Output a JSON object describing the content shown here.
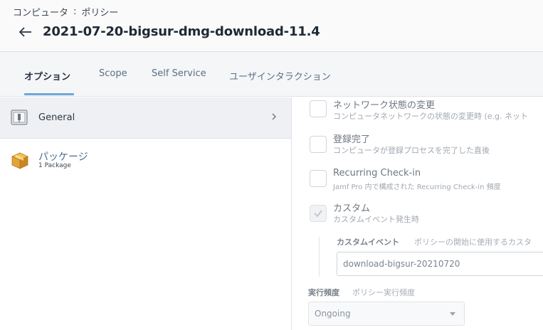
{
  "header": {
    "breadcrumb_parent": "コンピュータ",
    "breadcrumb_sep": ":",
    "breadcrumb_current": "ポリシー",
    "title": "2021-07-20-bigsur-dmg-download-11.4"
  },
  "tabs": [
    {
      "label": "オプション",
      "active": true
    },
    {
      "label": "Scope",
      "active": false
    },
    {
      "label": "Self Service",
      "active": false
    },
    {
      "label": "ユーザインタラクション",
      "active": false
    }
  ],
  "sidebar": {
    "items": [
      {
        "label": "General",
        "icon": "general-icon"
      },
      {
        "label": "パッケージ",
        "sub": "1 Package",
        "icon": "package-icon"
      }
    ]
  },
  "triggers": [
    {
      "title": "ネットワーク状態の変更",
      "desc": "コンピュータネットワークの状態の変更時 (e.g. ネット",
      "checked": false
    },
    {
      "title": "登録完了",
      "desc": "コンピュータが登録プロセスを完了した直後",
      "checked": false
    },
    {
      "title": "Recurring Check-in",
      "desc": "Jamf Pro 内で構成された Recurring Check-in 頻度",
      "checked": false
    },
    {
      "title": "カスタム",
      "desc": "カスタムイベント発生時",
      "checked": true
    }
  ],
  "custom_event": {
    "label": "カスタムイベント",
    "hint": "ポリシーの開始に使用するカスタ",
    "value": "download-bigsur-20210720"
  },
  "frequency": {
    "label": "実行頻度",
    "hint": "ポリシー実行頻度",
    "selected": "Ongoing"
  },
  "colors": {
    "accent": "#6ea7d8",
    "package_icon": "#e2a33a"
  }
}
